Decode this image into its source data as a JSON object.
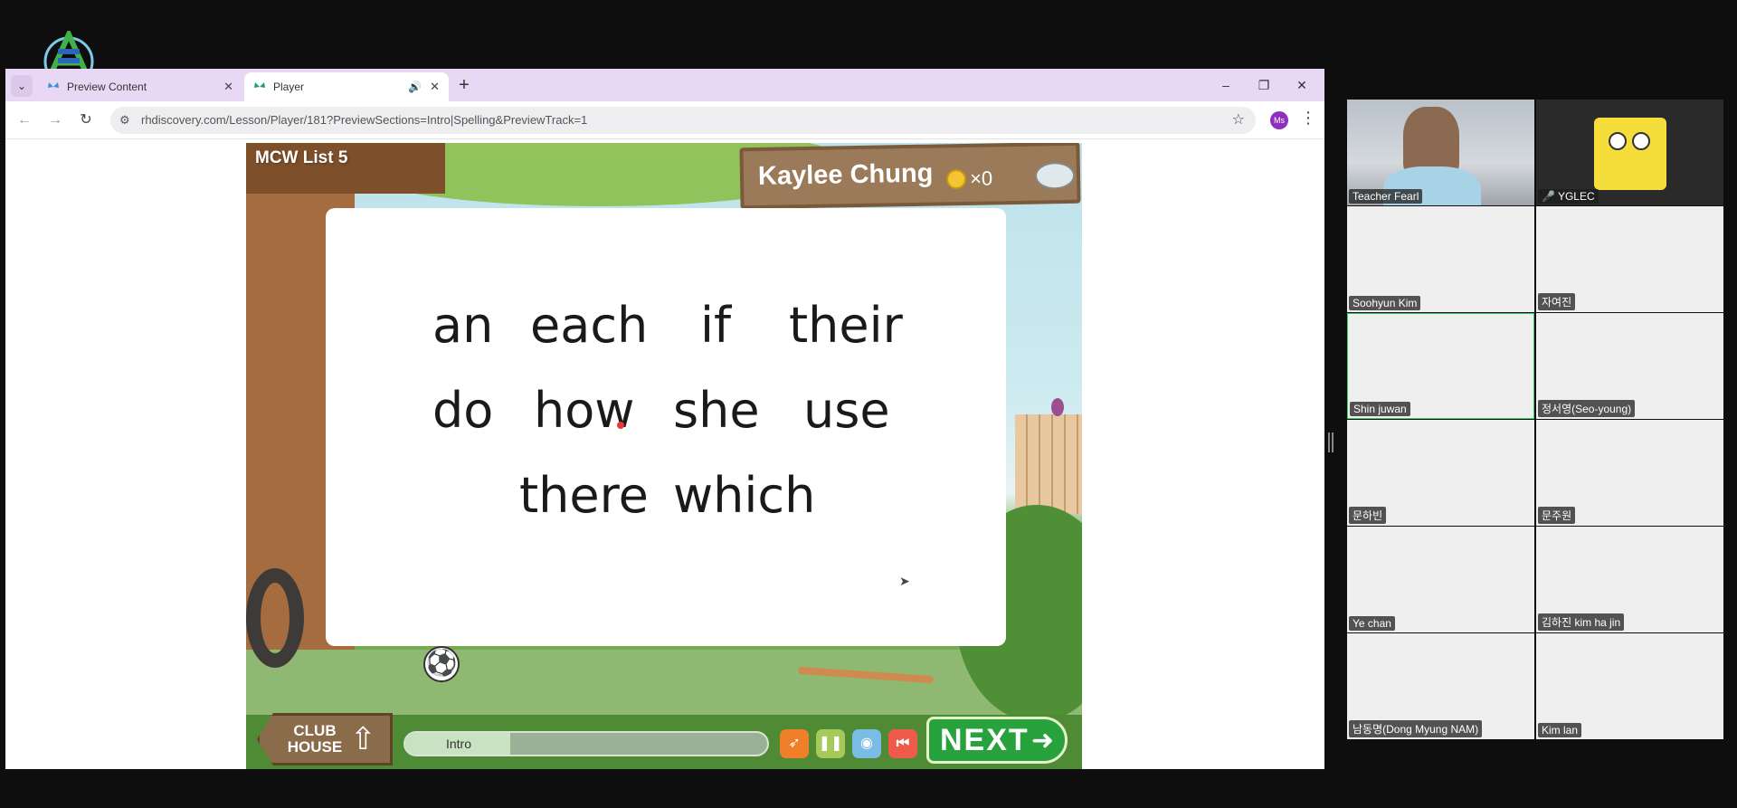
{
  "browser": {
    "tabs": [
      {
        "title": "Preview Content",
        "active": false
      },
      {
        "title": "Player",
        "active": true
      }
    ],
    "url": "rhdiscovery.com/Lesson/Player/181?PreviewSections=Intro|Spelling&PreviewTrack=1",
    "profile_initials": "Ms"
  },
  "player": {
    "lesson_title": "MCW List 5",
    "student_name": "Kaylee Chung",
    "coin_count": "×0",
    "words": [
      "an",
      "each",
      "if",
      "their",
      "do",
      "how",
      "she",
      "use",
      "there",
      "which"
    ],
    "clubhouse_label": "CLUB HOUSE",
    "progress_label": "Intro",
    "progress_fraction": 0.29,
    "next_label": "NEXT"
  },
  "participants": [
    {
      "name": "Teacher Fearl",
      "video": "camera"
    },
    {
      "name": "YGLEC",
      "video": "avatar",
      "muted": true
    },
    {
      "name": "Soohyun Kim",
      "video": "blurred"
    },
    {
      "name": "자여진",
      "video": "blurred"
    },
    {
      "name": "Shin juwan",
      "video": "blurred",
      "speaking": true
    },
    {
      "name": "정서영(Seo-young)",
      "video": "blurred"
    },
    {
      "name": "문하빈",
      "video": "blurred"
    },
    {
      "name": "문주원",
      "video": "blurred"
    },
    {
      "name": "Ye chan",
      "video": "blurred"
    },
    {
      "name": "김하진 kim ha jin",
      "video": "blurred"
    },
    {
      "name": "남동명(Dong Myung NAM)",
      "video": "blurred"
    },
    {
      "name": "Kim lan",
      "video": "blurred"
    }
  ],
  "icons": {
    "tab_list": "chevron-down-icon",
    "back": "arrow-left-icon",
    "forward": "arrow-right-icon",
    "reload": "reload-icon",
    "bookmark": "star-icon",
    "menu": "kebab-icon"
  },
  "colors": {
    "tabbar": "#e9d8f4",
    "next_button": "#27a23c",
    "speaking_border": "#36d06b"
  }
}
